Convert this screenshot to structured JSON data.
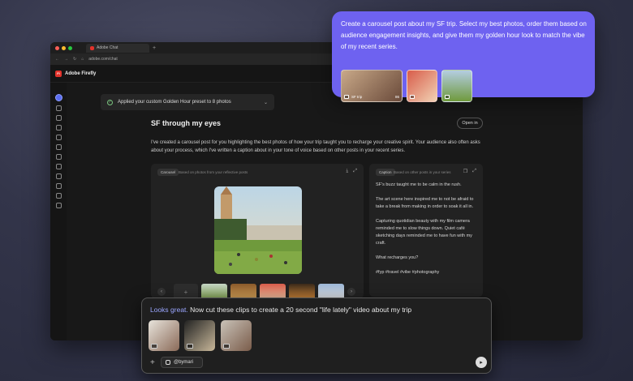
{
  "browser": {
    "tab_title": "Adobe Chat",
    "url": "adobe.com/chat"
  },
  "app": {
    "logo_text": "Fi",
    "title": "Adobe Firefly"
  },
  "conversation": {
    "applied_notice": "Applied your custom Golden Hour preset to 8 photos",
    "post_title": "SF through my eyes",
    "open_in_label": "Open in",
    "description": "I've created a carousel post for you highlighting the best photos of how your trip taught you to recharge your creative spirit. Your audience also often asks about your process, which I've written a caption about in your tone of voice based on other posts in your recent series."
  },
  "carousel_panel": {
    "tag": "Carousel",
    "subtitle": "Based on photos from your reflective posts"
  },
  "caption_panel": {
    "tag": "Caption",
    "subtitle": "Based on other posts in your series",
    "paragraphs": [
      "SF's buzz taught me to be calm in the rush.",
      "The art scene here inspired me to not be afraid to take a break from making in order to soak it all in.",
      "Capturing quotidian beauty with my film camera reminded me to slow things down. Quiet café sketching days reminded me to have fun with my craft.",
      "What recharges you?",
      "#fyp #travel #vibe #photography"
    ]
  },
  "prompt": {
    "lead": "Looks great.",
    "text": " Now cut these clips to create a 20 second \"life lately\" video about my trip",
    "handle": "@bymari"
  },
  "bubble": {
    "text": "Create a carousel post about my SF trip. Select my best photos, order them based on audience engagement insights, and give them my golden hour look to match the vibe of my recent series.",
    "album_label": "SF trip",
    "album_count": "86"
  },
  "colors": {
    "accent": "#6e62f0",
    "link": "#9aa6ff",
    "logo": "#e3322b"
  }
}
